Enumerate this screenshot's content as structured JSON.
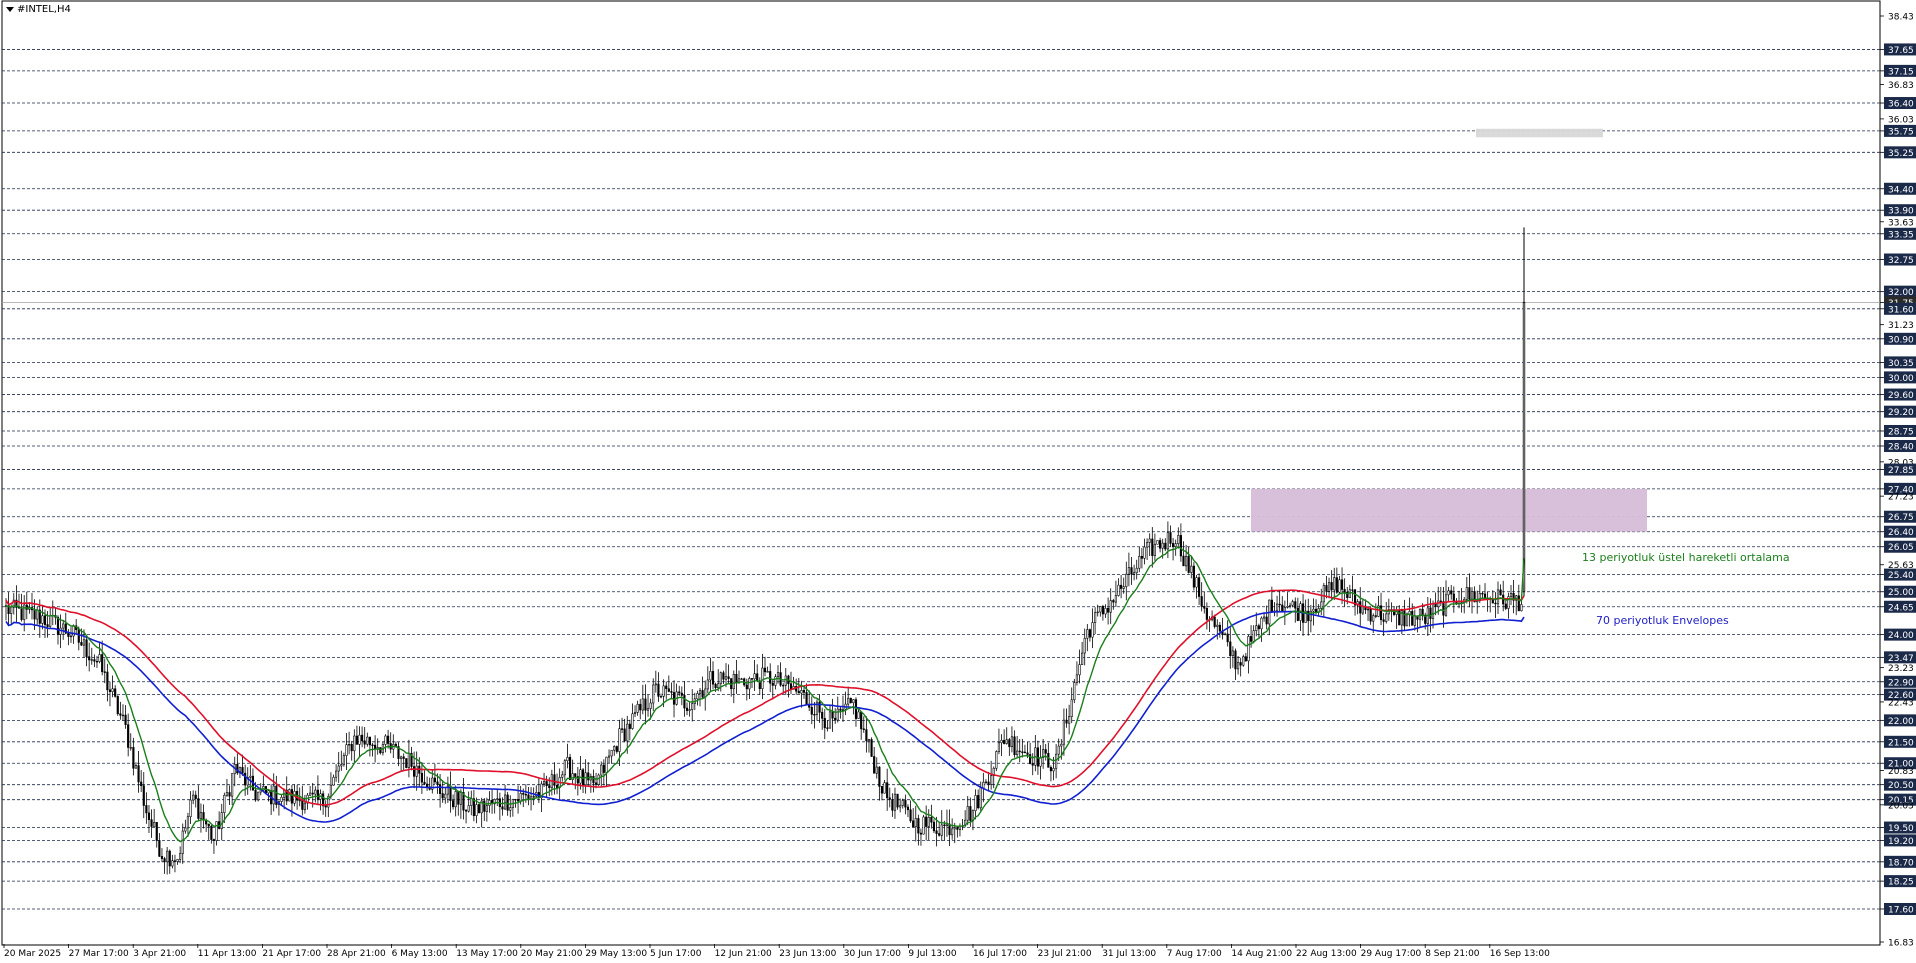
{
  "window": {
    "title": "#INTEL,H4"
  },
  "annotations": {
    "ema": "13 periyotluk üstel hareketli ortalama",
    "envelopes": "70 periyotluk Envelopes"
  },
  "colors": {
    "candle": "#000000",
    "ema": "#1a7f1a",
    "env_upper": "#e0102a",
    "env_lower": "#1020d0",
    "zone": "#d7bdd8",
    "small_zone": "#d8d8d8",
    "badge": "#1c2a4a",
    "hline": "#1c2a4a"
  },
  "chart_data": {
    "type": "candlestick",
    "symbol": "#INTEL",
    "timeframe": "H4",
    "ylim": [
      16.83,
      38.43
    ],
    "y_ticks": [
      "38.43",
      "37.65",
      "37.15",
      "36.83",
      "36.40",
      "36.03",
      "35.75",
      "35.25",
      "34.40",
      "33.90",
      "33.63",
      "33.35",
      "32.75",
      "32.00",
      "31.75",
      "31.60",
      "31.23",
      "30.90",
      "30.35",
      "30.00",
      "29.60",
      "29.20",
      "28.75",
      "28.40",
      "28.03",
      "27.85",
      "27.40",
      "27.23",
      "26.75",
      "26.40",
      "26.05",
      "25.63",
      "25.40",
      "25.00",
      "24.65",
      "24.00",
      "23.47",
      "23.23",
      "22.90",
      "22.60",
      "22.43",
      "22.00",
      "21.50",
      "21.00",
      "20.83",
      "20.50",
      "20.15",
      "20.03",
      "19.50",
      "19.20",
      "18.70",
      "18.25",
      "17.60",
      "16.83"
    ],
    "horizontal_levels": [
      37.65,
      37.15,
      36.4,
      35.75,
      35.25,
      34.4,
      33.9,
      33.35,
      32.75,
      32.0,
      31.6,
      30.9,
      30.35,
      30.0,
      29.6,
      29.2,
      28.75,
      28.4,
      27.85,
      27.4,
      26.75,
      26.4,
      26.05,
      25.4,
      25.0,
      24.65,
      24.0,
      23.47,
      22.9,
      22.6,
      22.0,
      21.5,
      21.0,
      20.5,
      20.15,
      19.5,
      19.2,
      18.7,
      18.25,
      17.6
    ],
    "current_price": 31.75,
    "x_labels": [
      "20 Mar 2025",
      "27 Mar 17:00",
      "3 Apr 21:00",
      "11 Apr 13:00",
      "21 Apr 17:00",
      "28 Apr 21:00",
      "6 May 13:00",
      "13 May 17:00",
      "20 May 21:00",
      "29 May 13:00",
      "5 Jun 17:00",
      "12 Jun 21:00",
      "23 Jun 13:00",
      "30 Jun 17:00",
      "9 Jul 13:00",
      "16 Jul 17:00",
      "23 Jul 21:00",
      "31 Jul 13:00",
      "7 Aug 17:00",
      "14 Aug 21:00",
      "22 Aug 13:00",
      "29 Aug 17:00",
      "8 Sep 21:00",
      "16 Sep 13:00"
    ],
    "zones": [
      {
        "name": "resistance-zone",
        "from": 26.4,
        "to": 27.4
      },
      {
        "name": "upper-zone",
        "from": 35.6,
        "to": 35.8
      }
    ],
    "close_path": [
      [
        0,
        24.6
      ],
      [
        14,
        24.4
      ],
      [
        26,
        24.0
      ],
      [
        36,
        23.3
      ],
      [
        46,
        21.8
      ],
      [
        54,
        19.9
      ],
      [
        60,
        18.9
      ],
      [
        66,
        18.8
      ],
      [
        72,
        20.2
      ],
      [
        80,
        19.2
      ],
      [
        88,
        20.9
      ],
      [
        96,
        20.3
      ],
      [
        110,
        20.2
      ],
      [
        122,
        20.1
      ],
      [
        134,
        21.6
      ],
      [
        146,
        21.4
      ],
      [
        156,
        21.0
      ],
      [
        166,
        20.4
      ],
      [
        180,
        19.9
      ],
      [
        190,
        20.1
      ],
      [
        206,
        20.3
      ],
      [
        216,
        20.9
      ],
      [
        226,
        20.4
      ],
      [
        236,
        21.6
      ],
      [
        250,
        22.7
      ],
      [
        262,
        22.4
      ],
      [
        272,
        23.0
      ],
      [
        282,
        22.9
      ],
      [
        294,
        23.0
      ],
      [
        306,
        22.6
      ],
      [
        318,
        21.9
      ],
      [
        326,
        22.4
      ],
      [
        338,
        20.3
      ],
      [
        350,
        19.6
      ],
      [
        362,
        19.5
      ],
      [
        372,
        19.9
      ],
      [
        384,
        21.6
      ],
      [
        394,
        21.2
      ],
      [
        404,
        21.0
      ],
      [
        416,
        24.1
      ],
      [
        428,
        25.0
      ],
      [
        440,
        26.0
      ],
      [
        450,
        26.3
      ],
      [
        462,
        24.5
      ],
      [
        474,
        23.3
      ],
      [
        488,
        24.8
      ],
      [
        500,
        24.5
      ],
      [
        512,
        25.2
      ],
      [
        522,
        24.6
      ],
      [
        534,
        24.4
      ],
      [
        546,
        24.4
      ],
      [
        558,
        24.9
      ],
      [
        568,
        24.9
      ],
      [
        576,
        24.8
      ],
      [
        583,
        24.8
      ]
    ],
    "series": [
      {
        "name": "13 periyotluk üstel hareketli ortalama",
        "type": "EMA",
        "period": 13
      },
      {
        "name": "70 periyotluk Envelopes",
        "type": "Envelopes",
        "period": 70
      }
    ],
    "spike": {
      "open": 25.0,
      "high": 33.5,
      "low": 24.9,
      "close": 31.75
    }
  }
}
